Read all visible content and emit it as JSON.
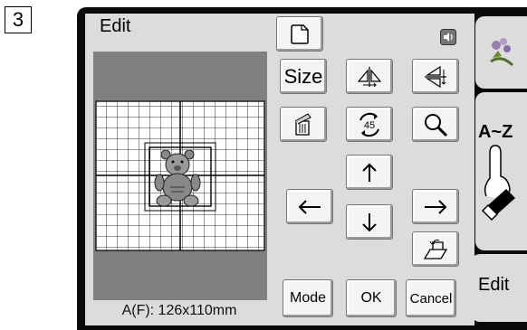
{
  "step_number": "3",
  "screen": {
    "title": "Edit",
    "size_info": "A(F): 126x110mm"
  },
  "buttons": {
    "size_label": "Size",
    "rotate_label": "45",
    "mode_label": "Mode",
    "ok_label": "OK",
    "cancel_label": "Cancel"
  },
  "tabs": {
    "font_label": "A~Z",
    "edit_label": "Edit"
  },
  "icons": {
    "new": "page-corner-icon",
    "sound": "speaker-icon",
    "mirror_horizontal": "mirror-horizontal-icon",
    "mirror_vertical": "mirror-vertical-icon",
    "delete": "trash-icon",
    "rotate": "rotate-45-icon",
    "zoom": "magnifier-icon",
    "arrow_up": "arrow-up-icon",
    "arrow_down": "arrow-down-icon",
    "arrow_left": "arrow-left-icon",
    "arrow_right": "arrow-right-icon",
    "hoop_move": "hoop-move-icon",
    "flower_tab": "flower-pattern-icon",
    "eraser": "eraser-icon"
  },
  "colors": {
    "bezel": "#0a0a0a",
    "screen": "#dcdcdc",
    "canvas_bg": "#808080",
    "grid": "#444444"
  }
}
